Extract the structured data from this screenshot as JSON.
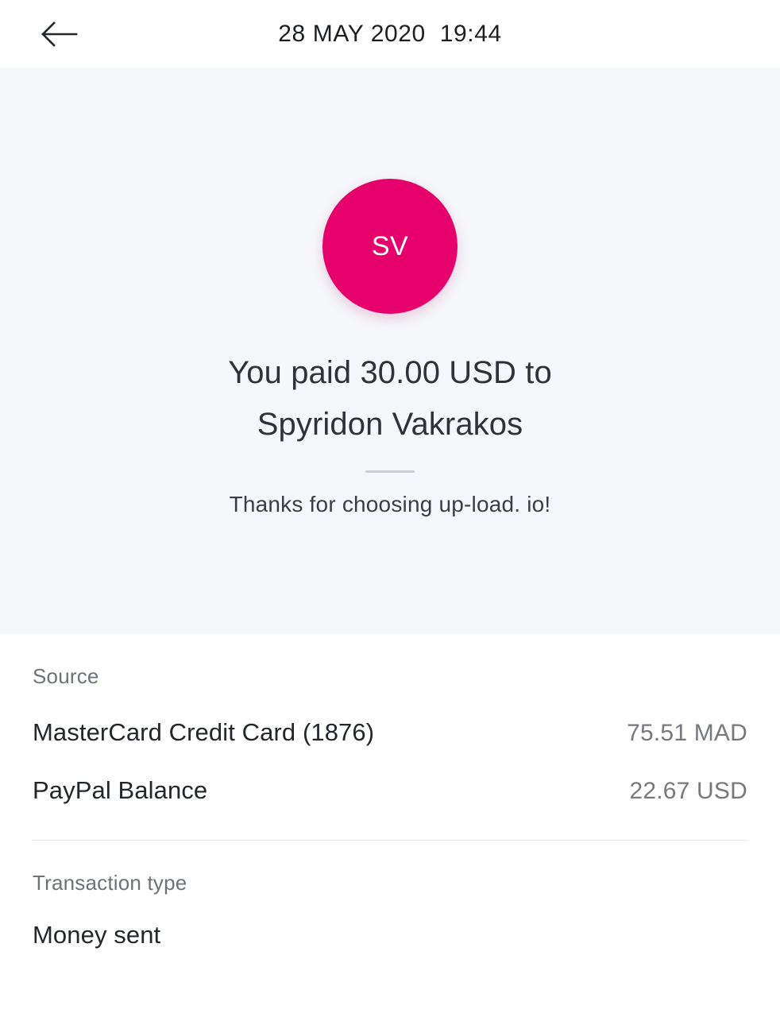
{
  "topbar": {
    "back_icon": "arrow-left-icon",
    "title": "28 MAY 2020  19:44"
  },
  "hero": {
    "avatar_initials": "SV",
    "avatar_color": "#e5006b",
    "background_color": "#f6f7fb",
    "title": "You paid 30.00 USD to Spyridon Vakrakos",
    "note": "Thanks for choosing up-load. io!"
  },
  "details": {
    "source": {
      "label": "Source",
      "rows": [
        {
          "name": "MasterCard Credit Card (1876)",
          "amount": "75.51 MAD"
        },
        {
          "name": "PayPal Balance",
          "amount": "22.67 USD"
        }
      ]
    },
    "transaction_type": {
      "label": "Transaction type",
      "value": "Money sent"
    }
  }
}
